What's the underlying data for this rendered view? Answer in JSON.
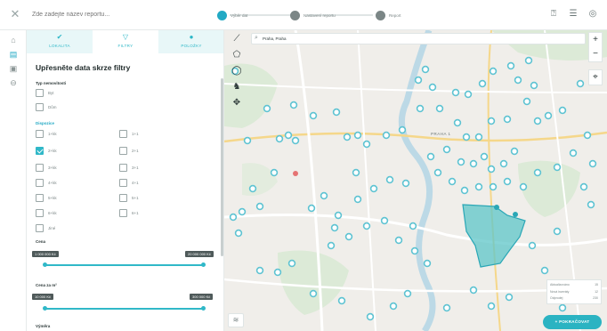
{
  "header": {
    "close_icon": "close-icon",
    "title_placeholder": "Zde zadejte název reportu...",
    "steps": [
      {
        "label": "Výběr dat",
        "active": true
      },
      {
        "label": "Nastavení reportu",
        "active": false
      },
      {
        "label": "Report",
        "active": false
      }
    ],
    "icons": [
      "help-icon",
      "menu-icon",
      "user-icon"
    ]
  },
  "rail": {
    "items": [
      "home-icon",
      "document-icon",
      "briefcase-icon",
      "settings-icon"
    ],
    "active_index": 1
  },
  "panel": {
    "tabs": [
      {
        "label": "LOKALITA",
        "icon": "check-circle-icon"
      },
      {
        "label": "FILTRY",
        "icon": "filter-icon"
      },
      {
        "label": "POLOŽKY",
        "icon": "pin-icon"
      }
    ],
    "active_tab": 1,
    "title": "Upřesněte data skrze filtry",
    "property_type": {
      "label": "Typ nemovitosti",
      "options": [
        {
          "label": "Byt",
          "checked": false
        },
        {
          "label": "Dům",
          "checked": false
        }
      ]
    },
    "layout": {
      "label": "Dispozice",
      "left": [
        {
          "label": "1+kk",
          "checked": false
        },
        {
          "label": "2+kk",
          "checked": true
        },
        {
          "label": "3+kk",
          "checked": false
        },
        {
          "label": "4+kk",
          "checked": false
        },
        {
          "label": "5+kk",
          "checked": false
        },
        {
          "label": "6+kk",
          "checked": false
        },
        {
          "label": "Jiné",
          "checked": false
        }
      ],
      "right": [
        {
          "label": "1+1",
          "checked": false
        },
        {
          "label": "2+1",
          "checked": false
        },
        {
          "label": "3+1",
          "checked": false
        },
        {
          "label": "4+1",
          "checked": false
        },
        {
          "label": "5+1",
          "checked": false
        },
        {
          "label": "6+1",
          "checked": false
        }
      ]
    },
    "price": {
      "label": "Cena",
      "min": "1 000 000 Kč",
      "max": "20 000 000 Kč"
    },
    "price_per_m2": {
      "label": "Cena za m²",
      "min": "10 000 Kč",
      "max": "300 000 Kč"
    },
    "area": {
      "label": "Výměra"
    }
  },
  "map": {
    "search_value": "Praha, Praha",
    "city_label": "PRAHA 1",
    "zoom_in": "+",
    "zoom_out": "−",
    "tools": [
      "draw-line-icon",
      "draw-polygon-icon",
      "circle-icon",
      "walk-icon",
      "move-icon"
    ],
    "legend": [
      {
        "label": "Aktualizováno",
        "value": "15"
      },
      {
        "label": "Nová inzeráty",
        "value": "12"
      },
      {
        "label": "Odprodej",
        "value": "230"
      }
    ],
    "cta_label": "+ POKRAČOVAT",
    "accent": "#2bb3c2"
  }
}
